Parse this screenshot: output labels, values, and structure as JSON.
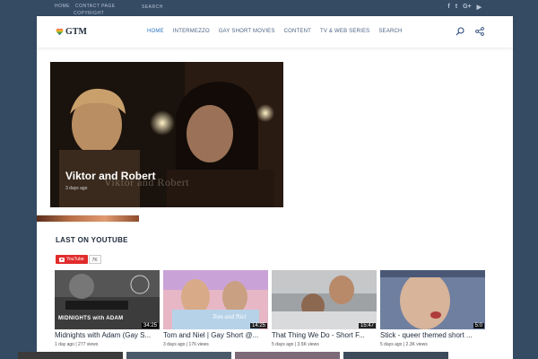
{
  "topbar": {
    "links": [
      "Home",
      "Contact Page"
    ],
    "copyright": "Copyright",
    "search": "Search",
    "social_icons": [
      "facebook-icon",
      "twitter-icon",
      "google-plus-icon",
      "youtube-icon"
    ],
    "social_glyphs": [
      "f",
      "t",
      "G+",
      "▶"
    ]
  },
  "header": {
    "logo": "GTM",
    "nav": [
      "Home",
      "Intermezzo",
      "Gay Short Movies",
      "Content",
      "TV & Web Series",
      "Search"
    ],
    "active_index": 0
  },
  "featured": {
    "title": "Viktor and Robert",
    "date": "3 days ago",
    "watermark": "Viktor and Robert"
  },
  "youtube": {
    "section_title": "LAST ON YOUTUBE",
    "button_label": "YouTube",
    "subscriber_count": "7K",
    "videos": [
      {
        "title": "Midnights with Adam (Gay S...",
        "duration": "34:25",
        "meta": "1 day ago | 277 views",
        "thumb_caption": "MIDNIGHTS with ADAM"
      },
      {
        "title": "Tom and Niel | Gay Short @...",
        "duration": "14:25",
        "meta": "3 days ago | 176 views",
        "thumb_caption": "Tom and Niel"
      },
      {
        "title": "That Thing We Do - Short F...",
        "duration": "15:47",
        "meta": "5 days ago | 3.5K views"
      },
      {
        "title": "Stick - queer themed short ...",
        "duration": "5:0",
        "meta": "5 days ago | 2.3K views"
      }
    ]
  },
  "colors": {
    "accent": "#2b72c4",
    "background": "#354a63",
    "youtube_red": "#e12b2b"
  }
}
